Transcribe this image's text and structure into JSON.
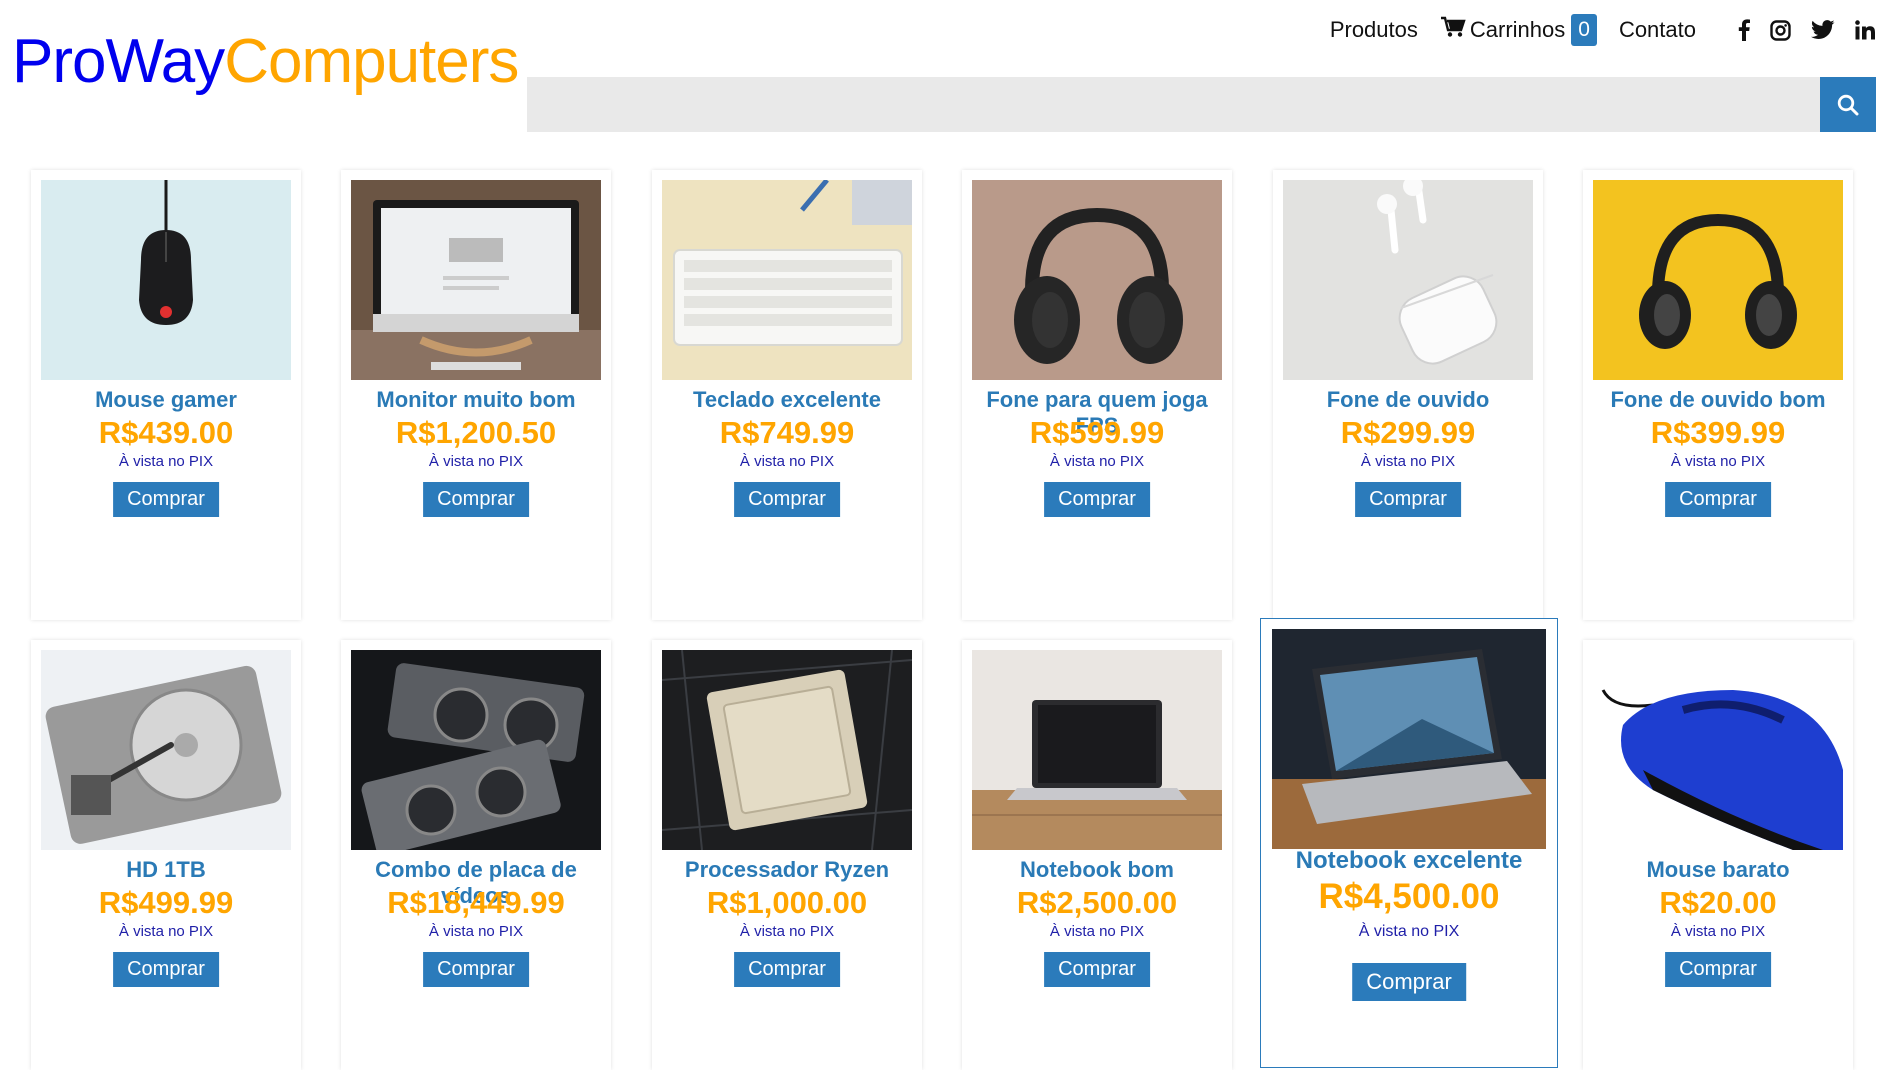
{
  "header": {
    "logo_part1": "ProWay",
    "logo_part2": "Computers",
    "nav": {
      "produtos": "Produtos",
      "carrinho": "Carrinhos",
      "cart_count": "0",
      "contato": "Contato"
    },
    "social_icons": [
      "facebook-icon",
      "instagram-icon",
      "twitter-icon",
      "linkedin-icon"
    ]
  },
  "search": {
    "placeholder": "",
    "value": ""
  },
  "products": [
    {
      "name": "Mouse gamer",
      "price": "R$439.00",
      "pix": "À vista no PIX",
      "button": "Comprar"
    },
    {
      "name": "Monitor muito bom",
      "price": "R$1,200.50",
      "pix": "À vista no PIX",
      "button": "Comprar"
    },
    {
      "name": "Teclado excelente",
      "price": "R$749.99",
      "pix": "À vista no PIX",
      "button": "Comprar"
    },
    {
      "name": "Fone para quem joga FPS",
      "price": "R$599.99",
      "pix": "À vista no PIX",
      "button": "Comprar"
    },
    {
      "name": "Fone de ouvido",
      "price": "R$299.99",
      "pix": "À vista no PIX",
      "button": "Comprar"
    },
    {
      "name": "Fone de ouvido bom",
      "price": "R$399.99",
      "pix": "À vista no PIX",
      "button": "Comprar"
    },
    {
      "name": "HD 1TB",
      "price": "R$499.99",
      "pix": "À vista no PIX",
      "button": "Comprar"
    },
    {
      "name": "Combo de placa de vídeos",
      "price": "R$18,449.99",
      "pix": "À vista no PIX",
      "button": "Comprar"
    },
    {
      "name": "Processador Ryzen",
      "price": "R$1,000.00",
      "pix": "À vista no PIX",
      "button": "Comprar"
    },
    {
      "name": "Notebook bom",
      "price": "R$2,500.00",
      "pix": "À vista no PIX",
      "button": "Comprar"
    },
    {
      "name": "Notebook excelente",
      "price": "R$4,500.00",
      "pix": "À vista no PIX",
      "button": "Comprar"
    },
    {
      "name": "Mouse barato",
      "price": "R$20.00",
      "pix": "À vista no PIX",
      "button": "Comprar"
    }
  ],
  "colors": {
    "brand_blue": "#0000ee",
    "brand_orange": "#ffa500",
    "accent": "#2b7bbb"
  }
}
